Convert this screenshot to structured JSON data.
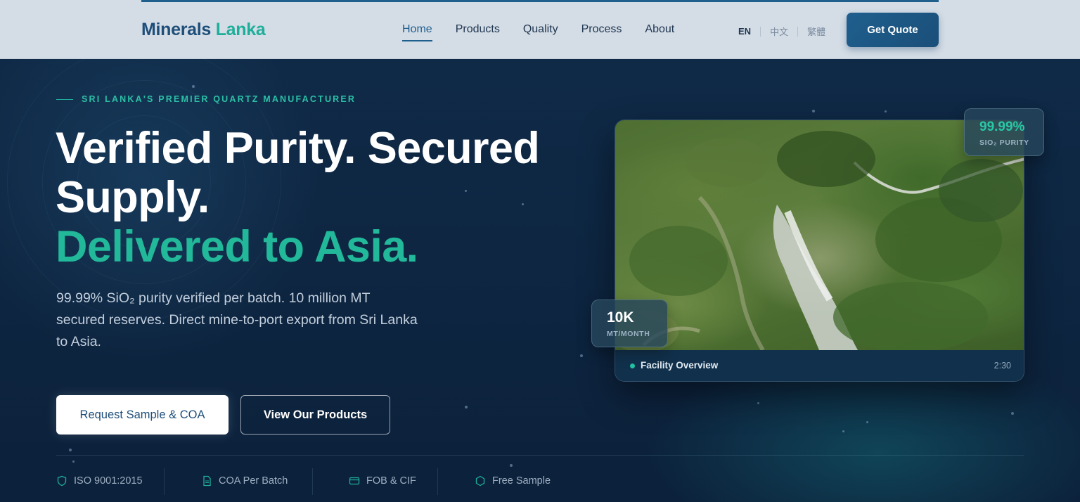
{
  "brand": {
    "part1": "Minerals",
    "part2": "Lanka"
  },
  "nav": {
    "items": [
      {
        "label": "Home",
        "active": true
      },
      {
        "label": "Products"
      },
      {
        "label": "Quality"
      },
      {
        "label": "Process"
      },
      {
        "label": "About"
      }
    ],
    "languages": [
      "EN",
      "中文",
      "繁體"
    ],
    "active_language": "EN",
    "cta_label": "Get Quote"
  },
  "hero": {
    "eyebrow": "SRI LANKA'S PREMIER QUARTZ MANUFACTURER",
    "headline_line1": "Verified Purity. Secured",
    "headline_line2": "Supply.",
    "headline_accent": "Delivered to Asia.",
    "description": "99.99% SiO₂ purity verified per batch. 10 million MT secured reserves. Direct mine-to-port export from Sri Lanka to Asia.",
    "primary_button": "Request Sample & COA",
    "secondary_button": "View Our Products"
  },
  "video": {
    "title": "Facility Overview",
    "duration": "2:30"
  },
  "badges": {
    "purity_value": "99.99%",
    "purity_label": "SIO₂ PURITY",
    "volume_value": "10K",
    "volume_label": "MT/MONTH"
  },
  "trust_items": [
    {
      "label": "ISO 9001:2015",
      "icon": "shield-icon"
    },
    {
      "label": "COA Per Batch",
      "icon": "document-icon"
    },
    {
      "label": "FOB & CIF",
      "icon": "card-icon"
    },
    {
      "label": "Free Sample",
      "icon": "hexagon-icon"
    }
  ],
  "colors": {
    "navy": "#1f4e79",
    "teal": "#22b89a",
    "hero_bg": "#0d2340",
    "nav_bg": "#d4dde6"
  }
}
